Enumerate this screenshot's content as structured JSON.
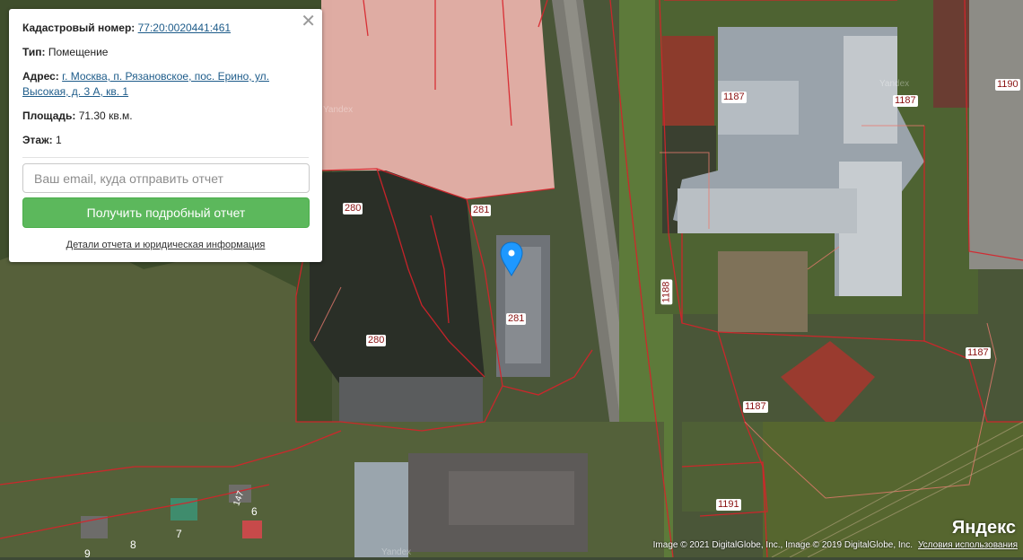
{
  "popup": {
    "cadastral_label": "Кадастровый номер:",
    "cadastral_number": "77:20:0020441:461",
    "type_label": "Тип:",
    "type_value": "Помещение",
    "address_label": "Адрес:",
    "address_value": "г. Москва, п. Рязановское, пос. Ерино, ул. Высокая, д. 3 А, кв. 1",
    "area_label": "Площадь:",
    "area_value": "71.30 кв.м.",
    "floor_label": "Этаж:",
    "floor_value": "1",
    "close_icon": "close-icon",
    "email_placeholder": "Ваш email, куда отправить отчет",
    "report_button": "Получить подробный отчет",
    "details_link": "Детали отчета и юридическая информация"
  },
  "map": {
    "parcel_labels": [
      "1187",
      "1187",
      "1190",
      "280",
      "281",
      "281",
      "280",
      "1188",
      "1187",
      "1187",
      "1191"
    ],
    "plot_numbers": [
      "147",
      "6",
      "7",
      "8",
      "9"
    ],
    "watermarks": [
      "Yandex",
      "Yandex",
      "Yandex"
    ],
    "marker_icon": "map-pin-icon",
    "colors": {
      "highlight_parcel": "#f4a6a6",
      "boundary": "#d8222a",
      "marker": "#1e98ff",
      "button": "#5cb85c"
    }
  },
  "footer": {
    "attribution": "Image © 2021 DigitalGlobe, Inc., Image © 2019 DigitalGlobe, Inc.",
    "terms_link": "Условия использования",
    "logo": "Яндекс"
  }
}
